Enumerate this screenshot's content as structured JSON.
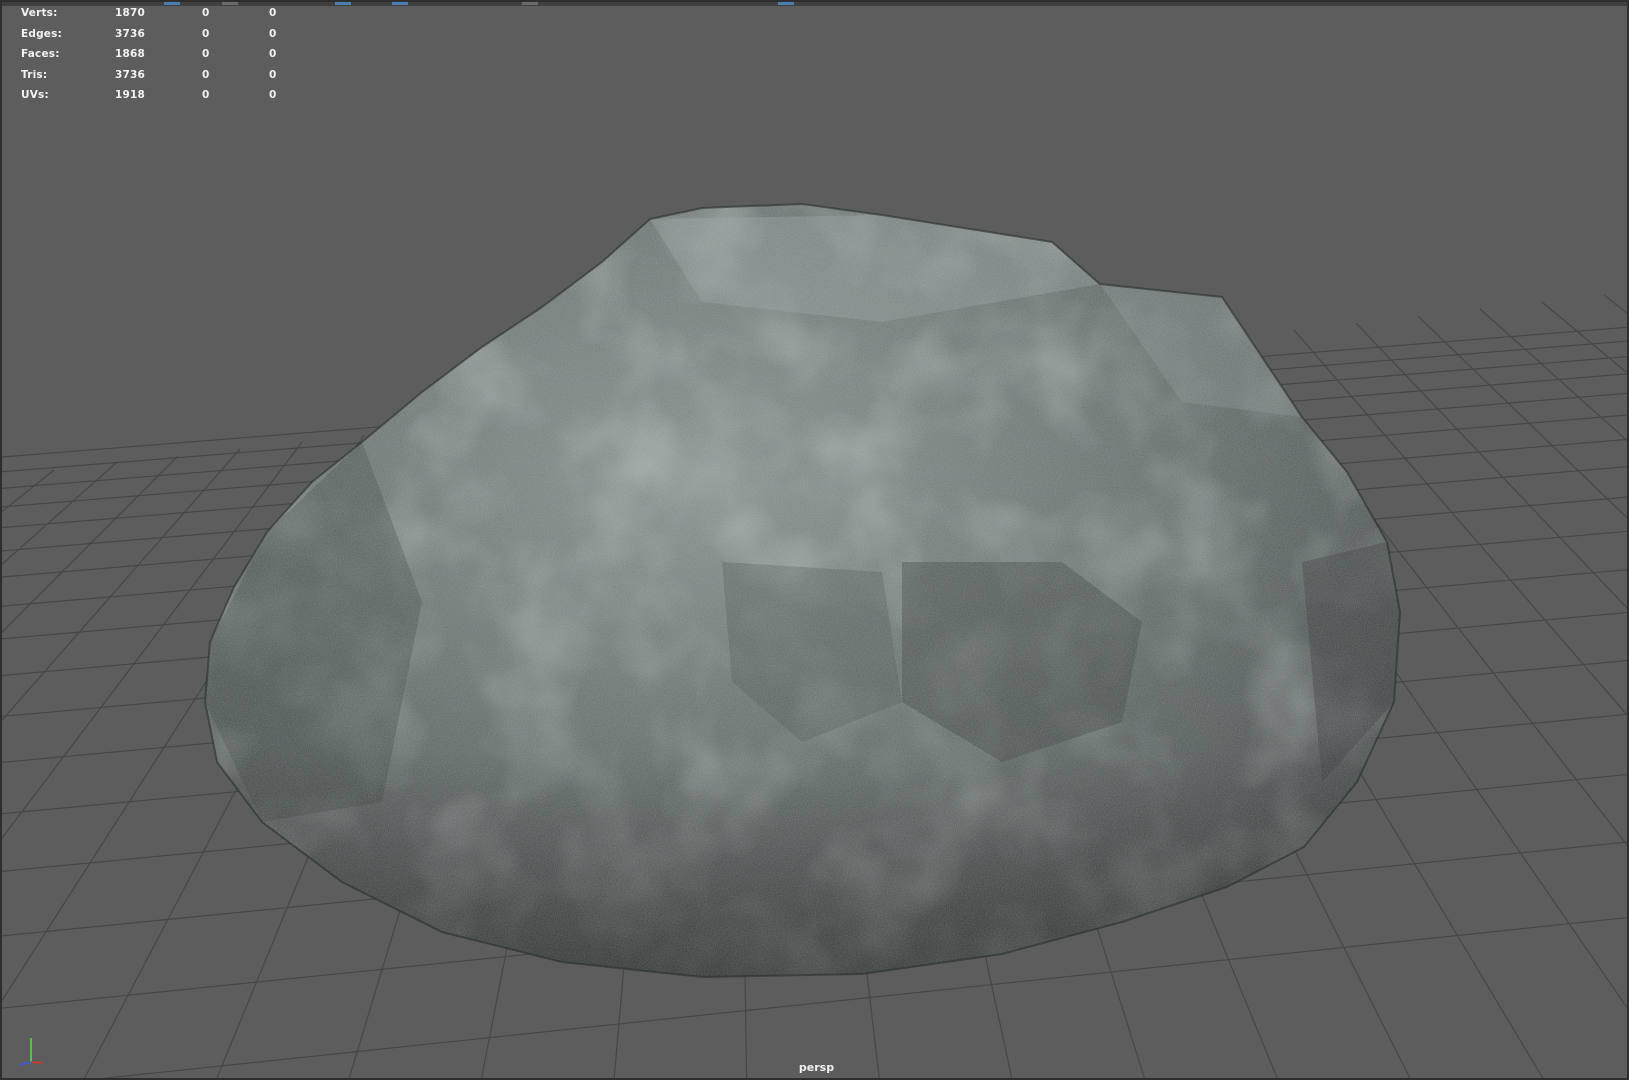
{
  "viewport": {
    "camera": "persp",
    "colors": {
      "background": "#5d5d5d",
      "grid": "#474747",
      "rock_base": "#5c6463",
      "rock_highlight": "#a7b0ae",
      "rock_shadow": "#2f3433"
    }
  },
  "hud": {
    "rows": [
      {
        "label": "Verts:",
        "total": "1870",
        "selected": "0",
        "extra": "0"
      },
      {
        "label": "Edges:",
        "total": "3736",
        "selected": "0",
        "extra": "0"
      },
      {
        "label": "Faces:",
        "total": "1868",
        "selected": "0",
        "extra": "0"
      },
      {
        "label": "Tris:",
        "total": "3736",
        "selected": "0",
        "extra": "0"
      },
      {
        "label": "UVs:",
        "total": "1918",
        "selected": "0",
        "extra": "0"
      }
    ]
  },
  "gizmo": {
    "icon": "xyz-axis-icon",
    "x_color": "#e0322b",
    "y_color": "#5ed63e",
    "z_color": "#3b5ce0"
  }
}
